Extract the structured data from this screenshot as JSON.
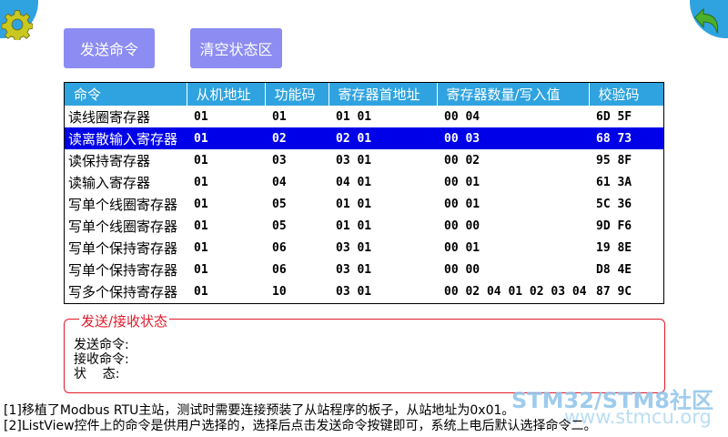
{
  "toolbar": {
    "send_label": "发送命令",
    "clear_label": "清空状态区"
  },
  "table": {
    "headers": [
      "命令",
      "从机地址",
      "功能码",
      "寄存器首地址",
      "寄存器数量/写入值",
      "校验码"
    ],
    "rows": [
      [
        "读线圈寄存器",
        "01",
        "01",
        "01 01",
        "00 04",
        "6D 5F"
      ],
      [
        "读离散输入寄存器",
        "01",
        "02",
        "02 01",
        "00 03",
        "68 73"
      ],
      [
        "读保持寄存器",
        "01",
        "03",
        "03 01",
        "00 02",
        "95 8F"
      ],
      [
        "读输入寄存器",
        "01",
        "04",
        "04 01",
        "00 01",
        "61 3A"
      ],
      [
        "写单个线圈寄存器",
        "01",
        "05",
        "01 01",
        "00 01",
        "5C 36"
      ],
      [
        "写单个线圈寄存器",
        "01",
        "05",
        "01 01",
        "00 00",
        "9D F6"
      ],
      [
        "写单个保持寄存器",
        "01",
        "06",
        "03 01",
        "00 01",
        "19 8E"
      ],
      [
        "写单个保持寄存器",
        "01",
        "06",
        "03 01",
        "00 00",
        "D8 4E"
      ],
      [
        "写多个保持寄存器",
        "01",
        "10",
        "03 01",
        "00 02 04 01 02 03 04",
        "87 9C"
      ]
    ],
    "selected_index": 1
  },
  "status": {
    "title": "发送/接收状态",
    "send_label": "发送命令:",
    "recv_label": "接收命令:",
    "state_label": "状    态:"
  },
  "notes": {
    "line1": "[1]移植了Modbus RTU主站，测试时需要连接预装了从站程序的板子，从站地址为0x01。",
    "line2": "[2]ListView控件上的命令是供用户选择的，选择后点击发送命令按键即可，系统上电后默认选择命令二。"
  },
  "watermark": {
    "line1": "STM32/STM8社区",
    "line2": "www.stmcu.org"
  },
  "icons": {
    "settings": "gear-icon",
    "back": "back-arrow-icon"
  },
  "colors": {
    "accent": "#2fa3e0",
    "button": "#8c8cf2",
    "selection": "#0000e8",
    "status_border": "#e01a2a",
    "gear": "#c8c820"
  }
}
